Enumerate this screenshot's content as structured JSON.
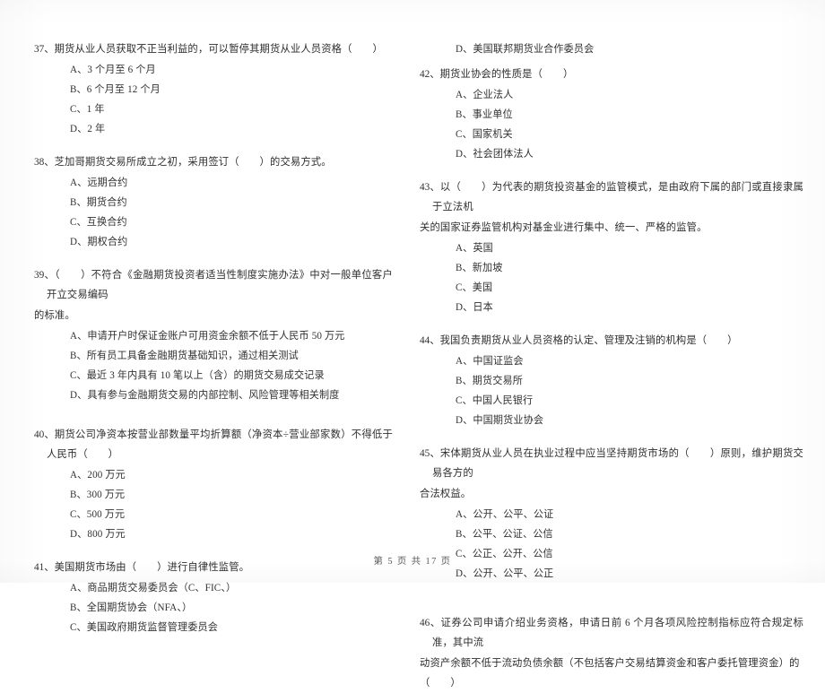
{
  "document": {
    "footer": "第 5 页  共 17 页",
    "page_number": "5",
    "total_pages": "17"
  },
  "left_column": {
    "questions": [
      {
        "number": "37、",
        "stem": "期货从业人员获取不正当利益的，可以暂停其期货从业人员资格（　　）",
        "options": [
          "A、3 个月至 6 个月",
          "B、6 个月至 12 个月",
          "C、1 年",
          "D、2 年"
        ]
      },
      {
        "number": "38、",
        "stem": "芝加哥期货交易所成立之初，采用签订（　　）的交易方式。",
        "options": [
          "A、远期合约",
          "B、期货合约",
          "C、互换合约",
          "D、期权合约"
        ]
      },
      {
        "number": "39、",
        "stem": "（　　）不符合《金融期货投资者适当性制度实施办法》中对一般单位客户开立交易编码",
        "stem_cont": "的标准。",
        "options": [
          "A、申请开户时保证金账户可用资金余额不低于人民币 50 万元",
          "B、所有员工具备金融期货基础知识，通过相关测试",
          "C、最近 3 年内具有 10 笔以上（含）的期货交易成交记录",
          "D、具有参与金融期货交易的内部控制、风险管理等相关制度"
        ]
      },
      {
        "number": "40、",
        "stem": "期货公司净资本按营业部数量平均折算额（净资本÷营业部家数）不得低于人民币（　　）",
        "options": [
          "A、200 万元",
          "B、300 万元",
          "C、500 万元",
          "D、800 万元"
        ]
      },
      {
        "number": "41、",
        "stem": "美国期货市场由（　　）进行自律性监管。",
        "options": [
          "A、商品期货交易委员会（C、FIC、）",
          "B、全国期货协会（NFA、）",
          "C、美国政府期货监督管理委员会"
        ]
      }
    ]
  },
  "right_column": {
    "orphan_option": "D、美国联邦期货业合作委员会",
    "questions": [
      {
        "number": "42、",
        "stem": "期货业协会的性质是（　　）",
        "options": [
          "A、企业法人",
          "B、事业单位",
          "C、国家机关",
          "D、社会团体法人"
        ]
      },
      {
        "number": "43、",
        "stem": "以（　　）为代表的期货投资基金的监管模式，是由政府下属的部门或直接隶属于立法机",
        "stem_cont": "关的国家证券监管机构对基金业进行集中、统一、严格的监管。",
        "options": [
          "A、英国",
          "B、新加坡",
          "C、美国",
          "D、日本"
        ]
      },
      {
        "number": "44、",
        "stem": "我国负责期货从业人员资格的认定、管理及注销的机构是（　　）",
        "options": [
          "A、中国证监会",
          "B、期货交易所",
          "C、中国人民银行",
          "D、中国期货业协会"
        ]
      },
      {
        "number": "45、",
        "stem": "宋体期货从业人员在执业过程中应当坚持期货市场的（　　）原则，维护期货交易各方的",
        "stem_cont": "合法权益。",
        "options": [
          "A、公开、公平、公证",
          "B、公平、公证、公信",
          "C、公正、公开、公信",
          "D、公开、公平、公正"
        ]
      },
      {
        "number": "46、",
        "stem": "证券公司申请介绍业务资格，申请日前 6 个月各项风险控制指标应符合规定标准，其中流",
        "stem_cont": "动资产余额不低于流动负债余额（不包括客户交易结算资金和客户委托管理资金）的（　　）",
        "options": []
      }
    ]
  }
}
